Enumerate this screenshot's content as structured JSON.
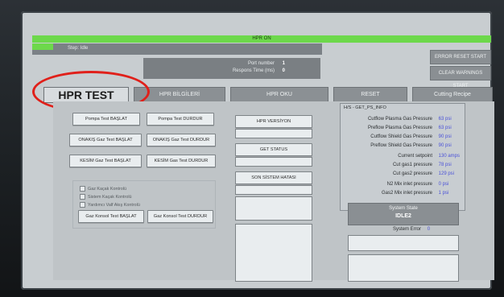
{
  "header": {
    "top_title": "HPR ON",
    "status_label": "Step: Idle"
  },
  "info": {
    "port_label": "Port number",
    "port_value": "1",
    "response_label": "Respons Time (ms)",
    "response_value": "0"
  },
  "right_buttons": {
    "error_reset": "ERROR RESET START",
    "clear_warnings": "CLEAR WARNINGS START"
  },
  "tabs": [
    {
      "label": "HPR TEST"
    },
    {
      "label": "HPR BİLGİLERİ"
    },
    {
      "label": "HPR OKU"
    },
    {
      "label": "RESET"
    },
    {
      "label": "Cutting Recipe"
    }
  ],
  "buttons": {
    "pump_start": "Pompa Test BAŞLAT",
    "pump_stop": "Pompa Test DURDUR",
    "preflow_start": "ONAKIŞ Gaz Test BAŞLAT",
    "preflow_stop": "ONAKIŞ Gaz Test DURDUR",
    "cutflow_start": "KESİM Gaz Test BAŞLAT",
    "cutflow_stop": "KESİM Gas Test DURDUR",
    "gas_console_start": "Gaz Konsol Test BAŞLAT",
    "gas_console_stop": "Gaz Konsol Test DURDUR",
    "hpr_version": "HPR VERSİYON",
    "get_status": "GET STATUS",
    "last_system_error": "SON SİSTEM HATASI"
  },
  "checkboxes": [
    "Gaz Kaçak Kontrolü",
    "Sistem Kaçak Kontrolü",
    "Yardımcı Valf Akış Kontrolü"
  ],
  "right_panel": {
    "title": "H/S - GET_PS_INFO",
    "rows": [
      {
        "label": "Cutflow Plasma Gas Pressure",
        "value": "63 psi"
      },
      {
        "label": "Preflow Plasma Gas Pressure",
        "value": "63 psi"
      },
      {
        "label": "Cutflow Shield Gas Pressure",
        "value": "90 psi"
      },
      {
        "label": "Preflow Shield Gas Pressure",
        "value": "90 psi"
      },
      {
        "label": "Current setpoint",
        "value": "130 amps"
      },
      {
        "label": "Cut gas1 pressure",
        "value": "78 psi"
      },
      {
        "label": "Cut gas2 pressure",
        "value": "129 psi"
      },
      {
        "label": "N2 Mix inlet pressure",
        "value": "0 psi"
      },
      {
        "label": "Gas2 Mix inlet pressure",
        "value": "1 psi"
      }
    ],
    "system_state_title": "System State",
    "system_state_value": "IDLE2",
    "system_error_label": "System Error",
    "system_error_value": "0"
  },
  "colors": {
    "green_bar": "#6dd84b",
    "highlight": "#e0201a",
    "value_blue": "#4b52d8"
  }
}
